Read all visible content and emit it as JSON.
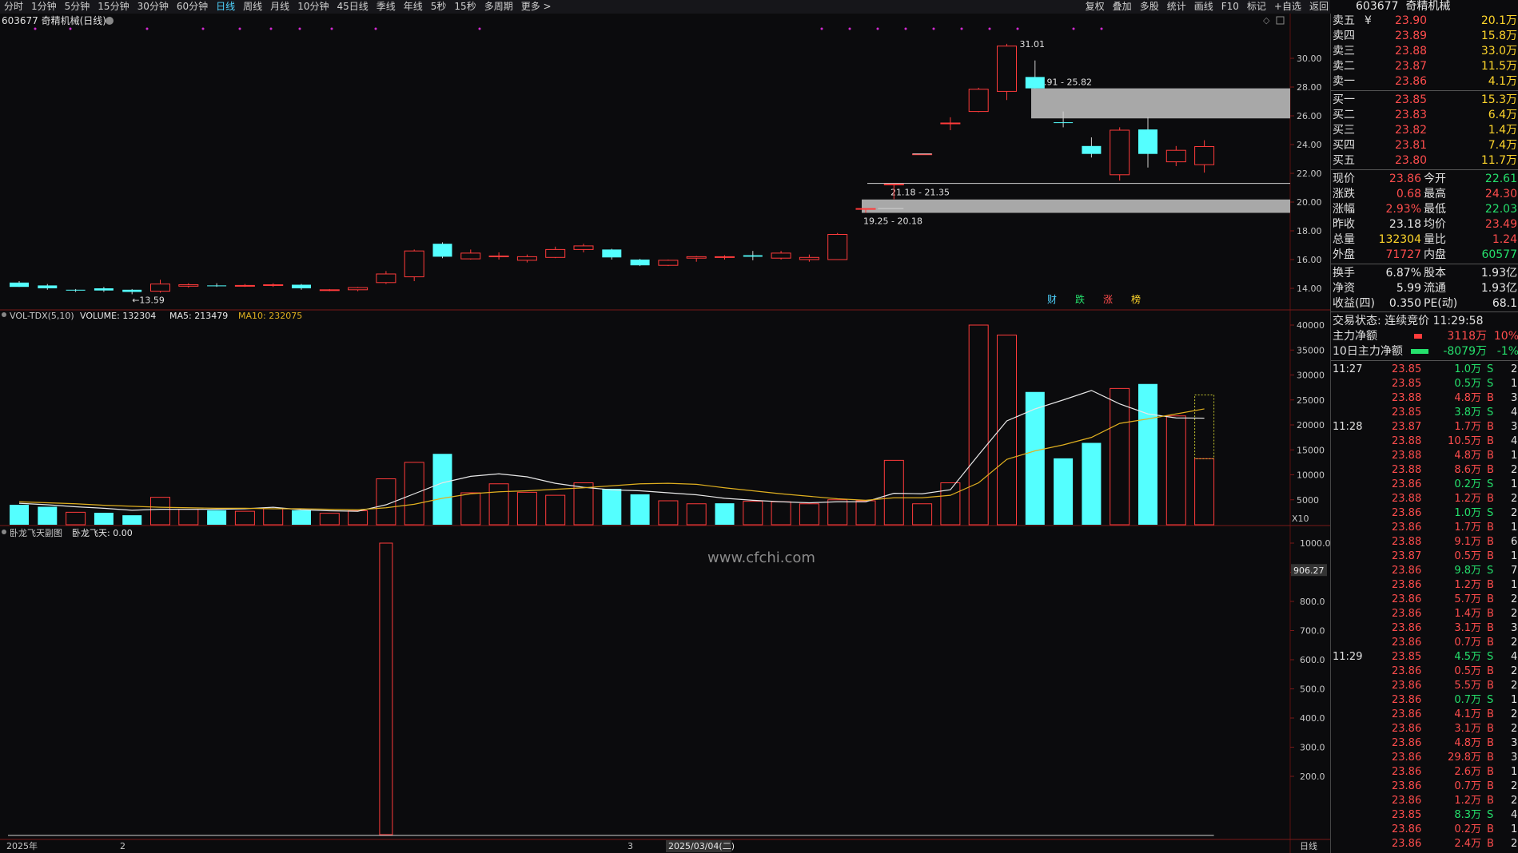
{
  "toolbar": {
    "periods": [
      {
        "label": "分时",
        "active": false
      },
      {
        "label": "1分钟",
        "active": false
      },
      {
        "label": "5分钟",
        "active": false
      },
      {
        "label": "15分钟",
        "active": false
      },
      {
        "label": "30分钟",
        "active": false
      },
      {
        "label": "60分钟",
        "active": false
      },
      {
        "label": "日线",
        "active": true
      },
      {
        "label": "周线",
        "active": false
      },
      {
        "label": "月线",
        "active": false
      },
      {
        "label": "10分钟",
        "active": false
      },
      {
        "label": "45日线",
        "active": false
      },
      {
        "label": "季线",
        "active": false
      },
      {
        "label": "年线",
        "active": false
      },
      {
        "label": "5秒",
        "active": false
      },
      {
        "label": "15秒",
        "active": false
      },
      {
        "label": "多周期",
        "active": false
      },
      {
        "label": "更多 >",
        "active": false
      }
    ],
    "tools": [
      "复权",
      "叠加",
      "多股",
      "统计",
      "画线",
      "F10",
      "标记",
      "+自选",
      "返回"
    ]
  },
  "stock": {
    "code": "603677",
    "name": "奇精机械",
    "chart_label": "603677 奇精机械(日线)"
  },
  "colors": {
    "up": "#ff3b3b",
    "down": "#54ffff",
    "ma5": "#e8e8e8",
    "ma10": "#e0b020",
    "grid": "#3a0a0a",
    "zone": "#a8a8a8",
    "marker": "#d22ad2"
  },
  "indicator_labels": {
    "vol": {
      "name": "VOL-TDX(5,10)",
      "volume": "VOLUME: 132304",
      "ma5": "MA5: 213479",
      "ma10": "MA10: 232075"
    },
    "sub": {
      "name": "卧龙飞天副图",
      "value": "卧龙飞天: 0.00"
    },
    "vol_unit": "X10",
    "cursor_value": "906.27"
  },
  "watermark": "www.cfchi.com",
  "xaxis": {
    "labels": [
      "2025年",
      "2",
      "3",
      "2025/03/04(二)"
    ],
    "period": "日线"
  },
  "annotations": {
    "high": "31.01",
    "low": "13.59",
    "zones": [
      "27.91 - 25.82",
      "21.18 - 21.35",
      "19.25 - 20.18"
    ],
    "event_tags": [
      {
        "text": "财",
        "color": "#4fd4ff"
      },
      {
        "text": "跌",
        "color": "#25e06c"
      },
      {
        "text": "涨",
        "color": "#ff4d4d"
      },
      {
        "text": "榜",
        "color": "#ffd62b"
      }
    ]
  },
  "chart_data": [
    {
      "type": "candlestick",
      "title": "603677 奇精机械(日线)",
      "ylim": [
        13.0,
        32.0
      ],
      "yticks": [
        14.0,
        16.0,
        18.0,
        20.0,
        22.0,
        24.0,
        26.0,
        28.0,
        30.0
      ],
      "candles": [
        {
          "o": 14.4,
          "h": 14.5,
          "l": 14.1,
          "c": 14.1
        },
        {
          "o": 14.2,
          "h": 14.3,
          "l": 13.9,
          "c": 14.0
        },
        {
          "o": 13.9,
          "h": 13.95,
          "l": 13.75,
          "c": 13.85
        },
        {
          "o": 14.0,
          "h": 14.1,
          "l": 13.75,
          "c": 13.85
        },
        {
          "o": 13.9,
          "h": 13.95,
          "l": 13.59,
          "c": 13.75
        },
        {
          "o": 13.8,
          "h": 14.6,
          "l": 13.7,
          "c": 14.3
        },
        {
          "o": 14.15,
          "h": 14.35,
          "l": 14.05,
          "c": 14.25
        },
        {
          "o": 14.2,
          "h": 14.35,
          "l": 14.1,
          "c": 14.15
        },
        {
          "o": 14.2,
          "h": 14.3,
          "l": 14.1,
          "c": 14.2
        },
        {
          "o": 14.2,
          "h": 14.35,
          "l": 14.1,
          "c": 14.25
        },
        {
          "o": 14.25,
          "h": 14.3,
          "l": 13.9,
          "c": 14.0
        },
        {
          "o": 13.85,
          "h": 13.95,
          "l": 13.8,
          "c": 13.9
        },
        {
          "o": 13.9,
          "h": 14.1,
          "l": 13.8,
          "c": 14.05
        },
        {
          "o": 14.4,
          "h": 15.2,
          "l": 14.3,
          "c": 15.0
        },
        {
          "o": 14.8,
          "h": 16.7,
          "l": 14.5,
          "c": 16.6
        },
        {
          "o": 17.1,
          "h": 17.2,
          "l": 16.1,
          "c": 16.2
        },
        {
          "o": 16.05,
          "h": 16.7,
          "l": 16.0,
          "c": 16.45
        },
        {
          "o": 16.2,
          "h": 16.5,
          "l": 16.0,
          "c": 16.25
        },
        {
          "o": 15.95,
          "h": 16.35,
          "l": 15.8,
          "c": 16.2
        },
        {
          "o": 16.15,
          "h": 16.9,
          "l": 16.1,
          "c": 16.7
        },
        {
          "o": 16.7,
          "h": 17.1,
          "l": 16.5,
          "c": 16.95
        },
        {
          "o": 16.7,
          "h": 16.75,
          "l": 16.0,
          "c": 16.15
        },
        {
          "o": 16.0,
          "h": 16.05,
          "l": 15.55,
          "c": 15.6
        },
        {
          "o": 15.6,
          "h": 16.0,
          "l": 15.55,
          "c": 15.95
        },
        {
          "o": 16.1,
          "h": 16.25,
          "l": 15.85,
          "c": 16.2
        },
        {
          "o": 16.15,
          "h": 16.3,
          "l": 16.0,
          "c": 16.2
        },
        {
          "o": 16.3,
          "h": 16.6,
          "l": 15.95,
          "c": 16.2
        },
        {
          "o": 16.1,
          "h": 16.6,
          "l": 16.0,
          "c": 16.45
        },
        {
          "o": 16.0,
          "h": 16.35,
          "l": 15.85,
          "c": 16.15
        },
        {
          "o": 16.0,
          "h": 17.85,
          "l": 16.0,
          "c": 17.75
        },
        {
          "o": 19.55,
          "h": 19.55,
          "l": 19.25,
          "c": 19.55
        },
        {
          "o": 21.25,
          "h": 21.25,
          "l": 20.2,
          "c": 21.25
        },
        {
          "o": 23.3,
          "h": 23.35,
          "l": 23.3,
          "c": 23.35
        },
        {
          "o": 25.5,
          "h": 25.9,
          "l": 25.0,
          "c": 25.5
        },
        {
          "o": 26.3,
          "h": 27.95,
          "l": 26.25,
          "c": 27.85
        },
        {
          "o": 27.7,
          "h": 31.01,
          "l": 27.1,
          "c": 30.85
        },
        {
          "o": 28.7,
          "h": 29.85,
          "l": 27.9,
          "c": 27.91
        },
        {
          "o": 25.55,
          "h": 26.3,
          "l": 25.2,
          "c": 25.5
        },
        {
          "o": 23.9,
          "h": 24.5,
          "l": 23.1,
          "c": 23.35
        },
        {
          "o": 21.9,
          "h": 25.2,
          "l": 21.5,
          "c": 25.0
        },
        {
          "o": 25.05,
          "h": 25.9,
          "l": 22.4,
          "c": 23.35
        },
        {
          "o": 22.8,
          "h": 23.9,
          "l": 22.5,
          "c": 23.6
        },
        {
          "o": 22.6,
          "h": 24.3,
          "l": 22.05,
          "c": 23.86
        }
      ]
    },
    {
      "type": "bar",
      "title": "VOL-TDX(5,10)",
      "ylim": [
        0,
        40000
      ],
      "yticks": [
        5000,
        10000,
        15000,
        20000,
        25000,
        30000,
        35000,
        40000
      ],
      "values": [
        4000,
        3600,
        2500,
        2400,
        1900,
        5500,
        3100,
        2900,
        2700,
        3200,
        2900,
        2300,
        2800,
        9200,
        12500,
        14200,
        6400,
        8200,
        6500,
        5900,
        8400,
        7200,
        6100,
        4800,
        4200,
        4300,
        4700,
        4600,
        4200,
        5000,
        4800,
        12900,
        4200,
        8400,
        40000,
        38000,
        26600,
        13300,
        16400,
        27300,
        28200,
        21800,
        13230
      ],
      "directions": [
        "down",
        "down",
        "up",
        "down",
        "down",
        "up",
        "up",
        "down",
        "up",
        "up",
        "down",
        "up",
        "up",
        "up",
        "up",
        "down",
        "up",
        "up",
        "up",
        "up",
        "up",
        "down",
        "down",
        "up",
        "up",
        "down",
        "up",
        "up",
        "up",
        "up",
        "up",
        "up",
        "up",
        "up",
        "up",
        "up",
        "down",
        "down",
        "down",
        "up",
        "down",
        "up",
        "up"
      ],
      "ma5": [
        4300,
        4000,
        3600,
        3300,
        2900,
        3100,
        3100,
        3100,
        3200,
        3500,
        3000,
        2800,
        2700,
        4000,
        6200,
        8400,
        9700,
        10200,
        9600,
        8300,
        7500,
        7000,
        6800,
        6400,
        6000,
        5300,
        4900,
        4600,
        4400,
        4600,
        4600,
        6300,
        6200,
        7000,
        14000,
        20800,
        23200,
        25000,
        26900,
        24200,
        22200,
        21400,
        21347
      ],
      "ma10": [
        4600,
        4400,
        4200,
        3900,
        3700,
        3500,
        3400,
        3300,
        3300,
        3200,
        3200,
        3100,
        3000,
        3400,
        4100,
        5300,
        6200,
        6600,
        6800,
        7100,
        7400,
        7800,
        8200,
        8300,
        8100,
        7400,
        6800,
        6200,
        5700,
        5200,
        4900,
        5400,
        5400,
        5900,
        8400,
        13100,
        14800,
        16000,
        17500,
        20300,
        21200,
        22200,
        23207
      ],
      "ma5_label": "MA5: 213479",
      "ma10_label": "MA10: 232075",
      "volume_label": "VOLUME: 132304"
    },
    {
      "type": "bar",
      "title": "卧龙飞天副图",
      "ylim": [
        0,
        1000
      ],
      "yticks": [
        200,
        300,
        400,
        500,
        600,
        700,
        800,
        900,
        1000
      ],
      "values": [
        {
          "index": 13,
          "value": 1000
        }
      ],
      "value_label": "卧龙飞天: 0.00"
    }
  ],
  "quote": {
    "asks": [
      {
        "label": "卖五",
        "sym": "¥",
        "price": "23.90",
        "vol": "20.1万"
      },
      {
        "label": "卖四",
        "sym": "",
        "price": "23.89",
        "vol": "15.8万"
      },
      {
        "label": "卖三",
        "sym": "",
        "price": "23.88",
        "vol": "33.0万"
      },
      {
        "label": "卖二",
        "sym": "",
        "price": "23.87",
        "vol": "11.5万"
      },
      {
        "label": "卖一",
        "sym": "",
        "price": "23.86",
        "vol": "4.1万"
      }
    ],
    "bids": [
      {
        "label": "买一",
        "price": "23.85",
        "vol": "15.3万"
      },
      {
        "label": "买二",
        "price": "23.83",
        "vol": "6.4万"
      },
      {
        "label": "买三",
        "price": "23.82",
        "vol": "1.4万"
      },
      {
        "label": "买四",
        "price": "23.81",
        "vol": "7.4万"
      },
      {
        "label": "买五",
        "price": "23.80",
        "vol": "11.7万"
      }
    ],
    "stats": [
      {
        "l1": "现价",
        "v1": "23.86",
        "c1": "red",
        "l2": "今开",
        "v2": "22.61",
        "c2": "grn"
      },
      {
        "l1": "涨跌",
        "v1": "0.68",
        "c1": "red",
        "l2": "最高",
        "v2": "24.30",
        "c2": "red"
      },
      {
        "l1": "涨幅",
        "v1": "2.93%",
        "c1": "red",
        "l2": "最低",
        "v2": "22.03",
        "c2": "grn"
      },
      {
        "l1": "昨收",
        "v1": "23.18",
        "c1": "wht",
        "l2": "均价",
        "v2": "23.49",
        "c2": "red"
      },
      {
        "l1": "总量",
        "v1": "132304",
        "c1": "yel",
        "l2": "量比",
        "v2": "1.24",
        "c2": "red"
      },
      {
        "l1": "外盘",
        "v1": "71727",
        "c1": "red",
        "l2": "内盘",
        "v2": "60577",
        "c2": "grn"
      }
    ],
    "stats2": [
      {
        "l1": "换手",
        "v1": "6.87%",
        "l2": "股本",
        "v2": "1.93亿"
      },
      {
        "l1": "净资",
        "v1": "5.99",
        "l2": "流通",
        "v2": "1.93亿"
      },
      {
        "l1": "收益(四)",
        "v1": "0.350",
        "l2": "PE(动)",
        "v2": "68.1"
      }
    ],
    "status": "交易状态: 连续竞价 11:29:58",
    "flow": [
      {
        "label": "主力净额",
        "value": "3118万",
        "pct": "10%",
        "color": "red"
      },
      {
        "label": "10日主力净额",
        "value": "-8079万",
        "pct": "-1%",
        "color": "grn"
      }
    ]
  },
  "ticks": [
    {
      "time": "11:27",
      "price": "23.85",
      "vol": "1.0万",
      "bs": "S",
      "n": "2"
    },
    {
      "time": "",
      "price": "23.85",
      "vol": "0.5万",
      "bs": "S",
      "n": "1"
    },
    {
      "time": "",
      "price": "23.88",
      "vol": "4.8万",
      "bs": "B",
      "n": "3"
    },
    {
      "time": "",
      "price": "23.85",
      "vol": "3.8万",
      "bs": "S",
      "n": "4"
    },
    {
      "time": "11:28",
      "price": "23.87",
      "vol": "1.7万",
      "bs": "B",
      "n": "3"
    },
    {
      "time": "",
      "price": "23.88",
      "vol": "10.5万",
      "bs": "B",
      "n": "4"
    },
    {
      "time": "",
      "price": "23.88",
      "vol": "4.8万",
      "bs": "B",
      "n": "1"
    },
    {
      "time": "",
      "price": "23.88",
      "vol": "8.6万",
      "bs": "B",
      "n": "2"
    },
    {
      "time": "",
      "price": "23.86",
      "vol": "0.2万",
      "bs": "S",
      "n": "1"
    },
    {
      "time": "",
      "price": "23.88",
      "vol": "1.2万",
      "bs": "B",
      "n": "2"
    },
    {
      "time": "",
      "price": "23.86",
      "vol": "1.0万",
      "bs": "S",
      "n": "2"
    },
    {
      "time": "",
      "price": "23.86",
      "vol": "1.7万",
      "bs": "B",
      "n": "1"
    },
    {
      "time": "",
      "price": "23.88",
      "vol": "9.1万",
      "bs": "B",
      "n": "6"
    },
    {
      "time": "",
      "price": "23.87",
      "vol": "0.5万",
      "bs": "B",
      "n": "1"
    },
    {
      "time": "",
      "price": "23.86",
      "vol": "9.8万",
      "bs": "S",
      "n": "7"
    },
    {
      "time": "",
      "price": "23.86",
      "vol": "1.2万",
      "bs": "B",
      "n": "1"
    },
    {
      "time": "",
      "price": "23.86",
      "vol": "5.7万",
      "bs": "B",
      "n": "2"
    },
    {
      "time": "",
      "price": "23.86",
      "vol": "1.4万",
      "bs": "B",
      "n": "2"
    },
    {
      "time": "",
      "price": "23.86",
      "vol": "3.1万",
      "bs": "B",
      "n": "3"
    },
    {
      "time": "",
      "price": "23.86",
      "vol": "0.7万",
      "bs": "B",
      "n": "2"
    },
    {
      "time": "11:29",
      "price": "23.85",
      "vol": "4.5万",
      "bs": "S",
      "n": "4"
    },
    {
      "time": "",
      "price": "23.86",
      "vol": "0.5万",
      "bs": "B",
      "n": "2"
    },
    {
      "time": "",
      "price": "23.86",
      "vol": "5.5万",
      "bs": "B",
      "n": "2"
    },
    {
      "time": "",
      "price": "23.86",
      "vol": "0.7万",
      "bs": "S",
      "n": "1"
    },
    {
      "time": "",
      "price": "23.86",
      "vol": "4.1万",
      "bs": "B",
      "n": "2"
    },
    {
      "time": "",
      "price": "23.86",
      "vol": "3.1万",
      "bs": "B",
      "n": "2"
    },
    {
      "time": "",
      "price": "23.86",
      "vol": "4.8万",
      "bs": "B",
      "n": "3"
    },
    {
      "time": "",
      "price": "23.86",
      "vol": "29.8万",
      "bs": "B",
      "n": "3"
    },
    {
      "time": "",
      "price": "23.86",
      "vol": "2.6万",
      "bs": "B",
      "n": "1"
    },
    {
      "time": "",
      "price": "23.86",
      "vol": "0.7万",
      "bs": "B",
      "n": "2"
    },
    {
      "time": "",
      "price": "23.86",
      "vol": "1.2万",
      "bs": "B",
      "n": "2"
    },
    {
      "time": "",
      "price": "23.85",
      "vol": "8.3万",
      "bs": "S",
      "n": "4"
    },
    {
      "time": "",
      "price": "23.86",
      "vol": "0.2万",
      "bs": "B",
      "n": "1"
    },
    {
      "time": "",
      "price": "23.86",
      "vol": "2.4万",
      "bs": "B",
      "n": "2"
    }
  ]
}
